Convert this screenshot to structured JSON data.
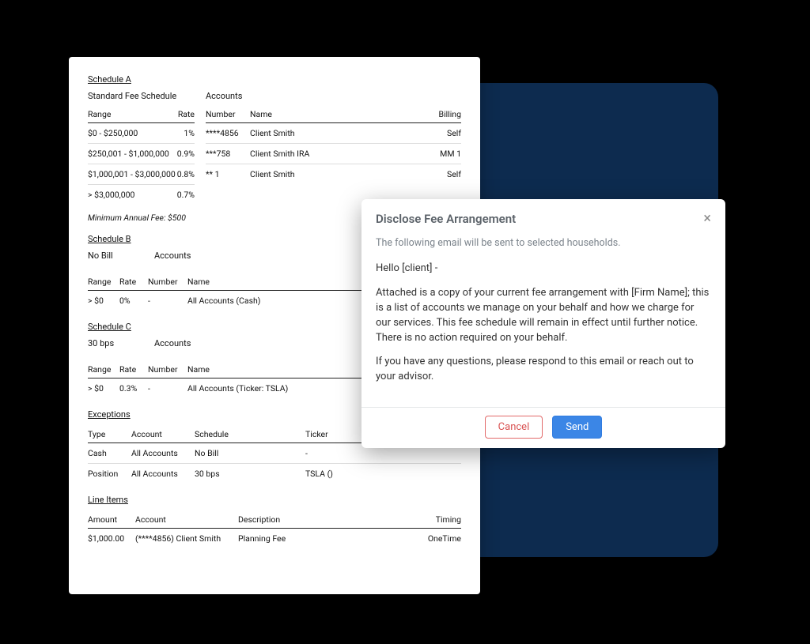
{
  "scheduleA": {
    "title": "Schedule A",
    "leftHeader": "Standard Fee Schedule",
    "rightHeader": "Accounts",
    "rangeCol": "Range",
    "rateCol": "Rate",
    "numberCol": "Number",
    "nameCol": "Name",
    "billingCol": "Billing",
    "tiers": [
      {
        "range": "$0 - $250,000",
        "rate": "1%"
      },
      {
        "range": "$250,001 - $1,000,000",
        "rate": "0.9%"
      },
      {
        "range": "$1,000,001 - $3,000,000",
        "rate": "0.8%"
      },
      {
        "range": "> $3,000,000",
        "rate": "0.7%"
      }
    ],
    "accounts": [
      {
        "num": "****4856",
        "name": "Client Smith",
        "billing": "Self"
      },
      {
        "num": "***758",
        "name": "Client Smith IRA",
        "billing": "MM 1"
      },
      {
        "num": "** 1",
        "name": "Client Smith",
        "billing": "Self"
      }
    ],
    "minFee": "Minimum Annual Fee: $500"
  },
  "scheduleB": {
    "title": "Schedule B",
    "leftHeader": "No Bill",
    "rightHeader": "Accounts",
    "rangeCol": "Range",
    "rateCol": "Rate",
    "numberCol": "Number",
    "nameCol": "Name",
    "rows": [
      {
        "range": "> $0",
        "rate": "0%",
        "num": "-",
        "name": "All Accounts (Cash)"
      }
    ]
  },
  "scheduleC": {
    "title": "Schedule C",
    "leftHeader": "30 bps",
    "rightHeader": "Accounts",
    "rangeCol": "Range",
    "rateCol": "Rate",
    "numberCol": "Number",
    "nameCol": "Name",
    "rows": [
      {
        "range": "> $0",
        "rate": "0.3%",
        "num": "-",
        "name": "All Accounts (Ticker: TSLA)"
      }
    ]
  },
  "exceptions": {
    "title": "Exceptions",
    "typeCol": "Type",
    "accountCol": "Account",
    "scheduleCol": "Schedule",
    "tickerCol": "Ticker",
    "rows": [
      {
        "type": "Cash",
        "account": "All Accounts",
        "schedule": "No Bill",
        "ticker": "-"
      },
      {
        "type": "Position",
        "account": "All Accounts",
        "schedule": "30 bps",
        "ticker": "TSLA ()"
      }
    ]
  },
  "lineItems": {
    "title": "Line Items",
    "amountCol": "Amount",
    "accountCol": "Account",
    "descCol": "Description",
    "timingCol": "Timing",
    "rows": [
      {
        "amount": "$1,000.00",
        "account": "(****4856) Client Smith",
        "desc": "Planning Fee",
        "timing": "OneTime"
      }
    ]
  },
  "modal": {
    "title": "Disclose Fee Arrangement",
    "desc": "The following email will be sent to selected households.",
    "greeting": "Hello [client] -",
    "body1": "Attached is a copy of your current fee arrangement with [Firm Name]; this is a list of accounts we manage on your behalf and how we charge for our services. This fee schedule will remain in effect until further notice. There is no action required on your behalf.",
    "body2": "If you have any questions, please respond to this email or reach out to your advisor.",
    "cancel": "Cancel",
    "send": "Send"
  }
}
